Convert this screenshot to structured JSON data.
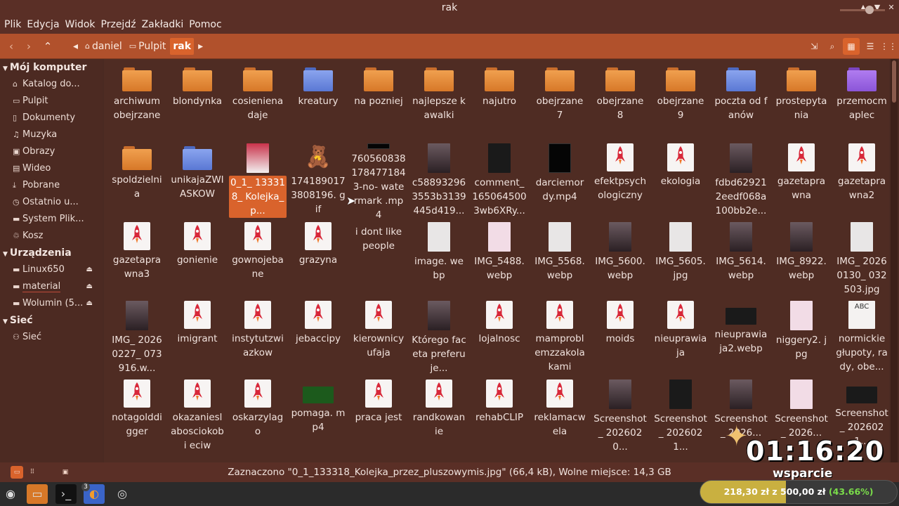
{
  "window": {
    "title": "rak",
    "buttons": [
      "▲",
      "▼",
      "✕"
    ]
  },
  "menu": [
    "Plik",
    "Edycja",
    "Widok",
    "Przejdź",
    "Zakładki",
    "Pomoc"
  ],
  "toolbar": {
    "back": "‹",
    "forward": "›",
    "up": "⌃",
    "crumb_prev": "◂",
    "crumb_next": "▸",
    "breadcrumbs": [
      {
        "label": "daniel",
        "icon": "home-icon"
      },
      {
        "label": "Pulpit",
        "icon": "folder-icon"
      },
      {
        "label": "rak",
        "icon": ""
      }
    ]
  },
  "sidebar": {
    "sections": [
      {
        "title": "Mój komputer",
        "items": [
          {
            "label": "Katalog do...",
            "icon": "home-icon"
          },
          {
            "label": "Pulpit",
            "icon": "folder-icon"
          },
          {
            "label": "Dokumenty",
            "icon": "documents-icon"
          },
          {
            "label": "Muzyka",
            "icon": "music-icon"
          },
          {
            "label": "Obrazy",
            "icon": "pictures-icon"
          },
          {
            "label": "Wideo",
            "icon": "video-icon"
          },
          {
            "label": "Pobrane",
            "icon": "download-icon"
          },
          {
            "label": "Ostatnio u...",
            "icon": "recent-icon"
          },
          {
            "label": "System Plik...",
            "icon": "drive-icon"
          },
          {
            "label": "Kosz",
            "icon": "trash-icon"
          }
        ]
      },
      {
        "title": "Urządzenia",
        "items": [
          {
            "label": "Linux650",
            "icon": "drive-icon"
          },
          {
            "label": "material",
            "icon": "drive-icon"
          },
          {
            "label": "Wolumin (5...",
            "icon": "drive-icon"
          }
        ]
      },
      {
        "title": "Sieć",
        "items": [
          {
            "label": "Sieć",
            "icon": "network-icon"
          }
        ]
      }
    ]
  },
  "files": [
    {
      "name": "archiwum obejrzane",
      "kind": "folder-orange"
    },
    {
      "name": "blondynka",
      "kind": "folder-orange"
    },
    {
      "name": "cosieniena daje",
      "kind": "folder-orange"
    },
    {
      "name": "kreatury",
      "kind": "folder-blue"
    },
    {
      "name": "na pozniej",
      "kind": "folder-orange"
    },
    {
      "name": "najlepsze kawalki",
      "kind": "folder-orange"
    },
    {
      "name": "najutro",
      "kind": "folder-orange"
    },
    {
      "name": "obejrzane 7",
      "kind": "folder-orange"
    },
    {
      "name": "obejrzane 8",
      "kind": "folder-orange"
    },
    {
      "name": "obejrzane 9",
      "kind": "folder-orange"
    },
    {
      "name": "poczta od fanów",
      "kind": "folder-blue"
    },
    {
      "name": "prostepyta nia",
      "kind": "folder-orange"
    },
    {
      "name": "przemocm aplec",
      "kind": "folder-purple"
    },
    {
      "name": "spoldzielni a",
      "kind": "folder-orange"
    },
    {
      "name": "unikajaZWI ASKOW",
      "kind": "folder-blue"
    },
    {
      "name": "0_1_ 133318_ Kolejka_p...",
      "kind": "thumb-red",
      "selected": true
    },
    {
      "name": "174189017 3808196. gif",
      "kind": "thumb-char"
    },
    {
      "name": "760560838 178477184 3-no- watermark .mp4",
      "kind": "thumb-black"
    },
    {
      "name": "c58893296 3553b3139 445d419...",
      "kind": "thumb-photo"
    },
    {
      "name": "comment_ 165064500 3wb6XRy...",
      "kind": "thumb-dark"
    },
    {
      "name": "darciemor dy.mp4",
      "kind": "thumb-black"
    },
    {
      "name": "efektpsych ologiczny",
      "kind": "doc"
    },
    {
      "name": "ekologia",
      "kind": "doc"
    },
    {
      "name": "fdbd62921 2eedf068a 100bb2e...",
      "kind": "thumb-photo"
    },
    {
      "name": "gazetapra wna",
      "kind": "doc"
    },
    {
      "name": "gazetapra wna2",
      "kind": "doc"
    },
    {
      "name": "gazetapra wna3",
      "kind": "doc"
    },
    {
      "name": "gonienie",
      "kind": "doc"
    },
    {
      "name": "gownojeba ne",
      "kind": "doc"
    },
    {
      "name": "grazyna",
      "kind": "doc"
    },
    {
      "name": "i dont like people",
      "kind": "thumb-none"
    },
    {
      "name": "image. webp",
      "kind": "thumb-light"
    },
    {
      "name": "IMG_5488. webp",
      "kind": "thumb-pink"
    },
    {
      "name": "IMG_5568. webp",
      "kind": "thumb-light"
    },
    {
      "name": "IMG_5600. webp",
      "kind": "thumb-photo"
    },
    {
      "name": "IMG_5605. jpg",
      "kind": "thumb-light"
    },
    {
      "name": "IMG_5614. webp",
      "kind": "thumb-photo"
    },
    {
      "name": "IMG_8922. webp",
      "kind": "thumb-photo"
    },
    {
      "name": "IMG_ 20260130_ 032503.jpg",
      "kind": "thumb-light"
    },
    {
      "name": "IMG_ 20260227_ 073916.w...",
      "kind": "thumb-photo"
    },
    {
      "name": "imigrant",
      "kind": "doc"
    },
    {
      "name": "instytutzwi azkow",
      "kind": "doc"
    },
    {
      "name": "jebaccipy",
      "kind": "doc"
    },
    {
      "name": "kierownicy ufaja",
      "kind": "doc"
    },
    {
      "name": "Którego faceta preferuje...",
      "kind": "thumb-photo"
    },
    {
      "name": "lojalnosc",
      "kind": "doc"
    },
    {
      "name": "mamprobl emzzakola kami",
      "kind": "doc"
    },
    {
      "name": "moids",
      "kind": "doc"
    },
    {
      "name": "nieuprawia ja",
      "kind": "doc"
    },
    {
      "name": "nieuprawia ja2.webp",
      "kind": "thumb-wide-dark"
    },
    {
      "name": "niggery2. jpg",
      "kind": "thumb-pink"
    },
    {
      "name": "normickie głupoty, rady, obe...",
      "kind": "thumb-abc"
    },
    {
      "name": "notagolddi gger",
      "kind": "doc"
    },
    {
      "name": "okazaniesl abosciokobi eciw",
      "kind": "doc"
    },
    {
      "name": "oskarzylag o",
      "kind": "doc"
    },
    {
      "name": "pomaga. mp4",
      "kind": "thumb-wide-green"
    },
    {
      "name": "praca jest",
      "kind": "doc"
    },
    {
      "name": "randkowan ie",
      "kind": "doc"
    },
    {
      "name": "rehabCLIP",
      "kind": "doc"
    },
    {
      "name": "reklamacw ela",
      "kind": "doc"
    },
    {
      "name": "Screenshot _ 2026020...",
      "kind": "thumb-photo"
    },
    {
      "name": "Screenshot _ 2026021...",
      "kind": "thumb-dark"
    },
    {
      "name": "Screenshot _ 2026...",
      "kind": "thumb-photo"
    },
    {
      "name": "Screenshot _ 2026...",
      "kind": "thumb-pink"
    },
    {
      "name": "Screenshot _ 2026021...",
      "kind": "thumb-wide-dark"
    }
  ],
  "statusbar": {
    "text": "Zaznaczono \"0_1_133318_Kolejka_przez_pluszowymis.jpg\" (66,4 kB), Wolne miejsce: 14,3 GB"
  },
  "taskbar": {
    "badge": "3"
  },
  "overlay": {
    "timer": "01:16:20",
    "label": "wsparcie",
    "donation_prefix": "218,30 zł z 500,00 zł",
    "donation_pct": "(43.66%)",
    "progress": 0.4366
  },
  "colors": {
    "accent": "#d9632c",
    "toolbar": "#b1512c",
    "background": "#4f2c23"
  }
}
